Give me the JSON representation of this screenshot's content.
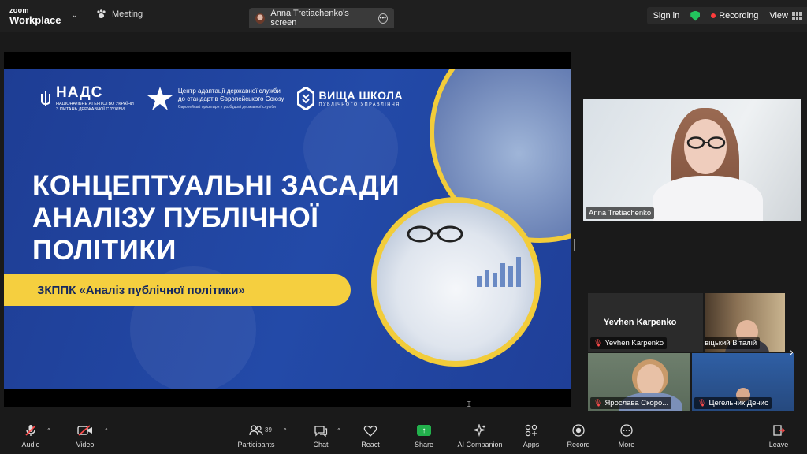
{
  "app": {
    "brand_line1": "zoom",
    "brand_line2": "Workplace"
  },
  "tabs": {
    "meeting": "Meeting",
    "screen_share": "Anna Tretiachenko's screen"
  },
  "top_right": {
    "sign_in": "Sign in",
    "recording": "Recording",
    "view": "View"
  },
  "slide": {
    "logo_nads_title": "НАДС",
    "logo_nads_sub1": "НАЦІОНАЛЬНЕ АГЕНТСТВО УКРАЇНИ",
    "logo_nads_sub2": "З ПИТАНЬ ДЕРЖАВНОЇ СЛУЖБИ",
    "logo_center_line1": "Центр адаптації державної служби",
    "logo_center_line2": "до стандартів Європейського Союзу",
    "logo_center_sub": "Європейські орієнтири у розбудові державної служби",
    "logo_school_title": "ВИЩА ШКОЛА",
    "logo_school_sub": "ПУБЛІЧНОГО УПРАВЛІННЯ",
    "title_line1": "КОНЦЕПТУАЛЬНІ ЗАСАДИ",
    "title_line2": "АНАЛІЗУ ПУБЛІЧНОЇ",
    "title_line3": "ПОЛІТИКИ",
    "banner": "ЗКППК «Аналіз публічної політики»"
  },
  "speaker": {
    "name": "Anna Tretiachenko"
  },
  "participants": [
    {
      "name": "Yevhen Karpenko",
      "display": "Yevhen Karpenko",
      "muted": true
    },
    {
      "name": "Савіцький Віталій",
      "muted": false
    },
    {
      "name": "Ярослава Скоро...",
      "muted": true
    },
    {
      "name": "Цегельник Денис",
      "muted": true
    }
  ],
  "toolbar": {
    "audio": "Audio",
    "video": "Video",
    "participants": "Participants",
    "participants_count": "39",
    "chat": "Chat",
    "react": "React",
    "share": "Share",
    "ai_companion": "AI Companion",
    "apps": "Apps",
    "record": "Record",
    "more": "More",
    "leave": "Leave"
  },
  "colors": {
    "slide_blue": "#234aa8",
    "accent_yellow": "#f5cf3f",
    "share_green": "#22b14c",
    "record_red": "#ff3b3b",
    "secure_green": "#23c45e"
  }
}
